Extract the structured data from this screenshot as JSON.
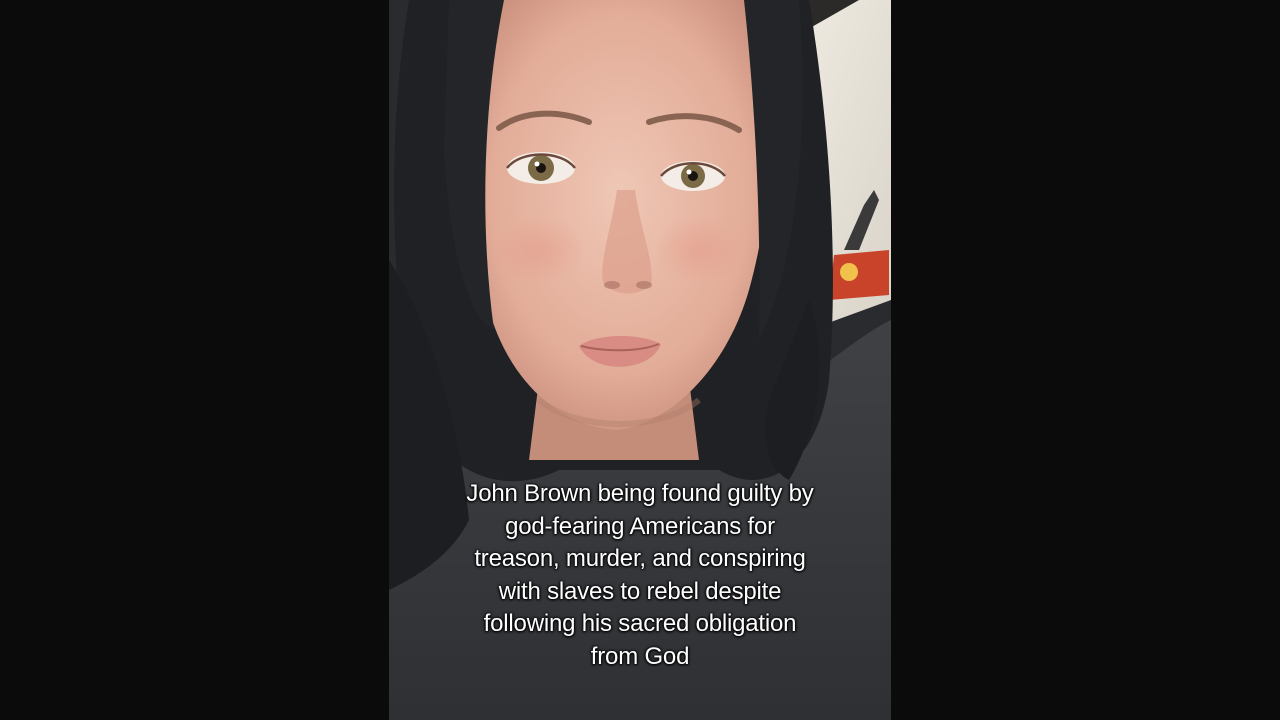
{
  "video": {
    "caption_lines": [
      "John Brown being found guilty by",
      "god-fearing Americans for",
      "treason, murder, and conspiring",
      "with slaves to rebel despite",
      "following his sacred obligation",
      "from God"
    ]
  },
  "colors": {
    "letterbox": "#0b0b0b",
    "caption_text": "#ffffff",
    "hair": "#1f2124",
    "shirt": "#3a3c40",
    "wall": "#e9e4da",
    "skin": "#e7b9a6"
  },
  "icons": {
    "subject": "person-selfie-photo"
  }
}
